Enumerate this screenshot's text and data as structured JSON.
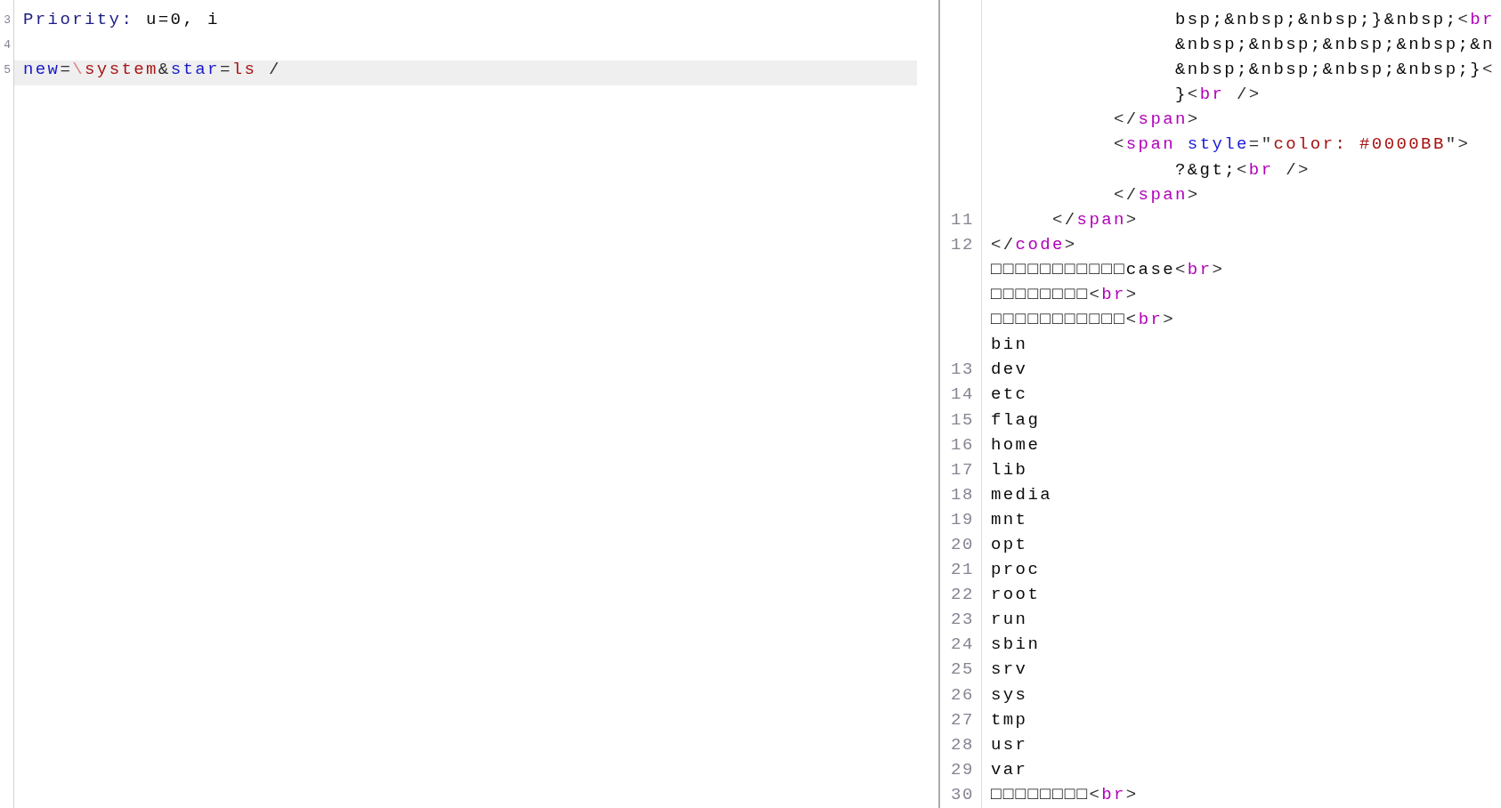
{
  "left_pane": {
    "lines": [
      {
        "number": "3",
        "highlighted": false,
        "tokens": [
          {
            "kind": "header",
            "text": "Priority:"
          },
          {
            "kind": "text",
            "text": " u=0, i"
          }
        ]
      },
      {
        "number": "4",
        "highlighted": false
      },
      {
        "number": "5",
        "highlighted": true,
        "tokens": [
          {
            "kind": "param",
            "text": "new"
          },
          {
            "kind": "punct",
            "text": "="
          },
          {
            "kind": "escape",
            "text": "\\"
          },
          {
            "kind": "value",
            "text": "system"
          },
          {
            "kind": "punct",
            "text": "&"
          },
          {
            "kind": "param",
            "text": "star"
          },
          {
            "kind": "punct",
            "text": "="
          },
          {
            "kind": "value",
            "text": "ls"
          },
          {
            "kind": "punct",
            "text": " /"
          }
        ]
      }
    ]
  },
  "right_pane": {
    "lines": [
      {
        "children": [
          {
            "children": [
              {
                "children": [
                  {
                    "tokens": [
                      {
                        "kind": "text",
                        "text": "bsp;&nbsp;&nbsp;}&nbsp;"
                      },
                      {
                        "kind": "punct",
                        "text": "<"
                      },
                      {
                        "kind": "tag",
                        "text": "br"
                      }
                    ]
                  },
                  {
                    "tokens": [
                      {
                        "kind": "text",
                        "text": "&nbsp;&nbsp;&nbsp;&nbsp;&n"
                      }
                    ]
                  },
                  {
                    "tokens": [
                      {
                        "kind": "text",
                        "text": "&nbsp;&nbsp;&nbsp;&nbsp;}"
                      },
                      {
                        "kind": "punct",
                        "text": "<"
                      }
                    ]
                  },
                  {
                    "tokens": [
                      {
                        "kind": "text",
                        "text": "}"
                      },
                      {
                        "kind": "punct",
                        "text": "<"
                      },
                      {
                        "kind": "tag",
                        "text": "br"
                      },
                      {
                        "kind": "punct",
                        "text": " />"
                      }
                    ]
                  }
                ]
              },
              {
                "tokens": [
                  {
                    "kind": "punct",
                    "text": "</"
                  },
                  {
                    "kind": "tag",
                    "text": "span"
                  },
                  {
                    "kind": "punct",
                    "text": ">"
                  }
                ]
              },
              {
                "tokens": [
                  {
                    "kind": "punct",
                    "text": "<"
                  },
                  {
                    "kind": "tag",
                    "text": "span"
                  },
                  {
                    "kind": "attr",
                    "text": " style"
                  },
                  {
                    "kind": "punct",
                    "text": "=\""
                  },
                  {
                    "kind": "string",
                    "text": "color: #0000BB"
                  },
                  {
                    "kind": "punct",
                    "text": "\">"
                  }
                ],
                "children": [
                  {
                    "tokens": [
                      {
                        "kind": "text",
                        "text": "?&gt;"
                      },
                      {
                        "kind": "punct",
                        "text": "<"
                      },
                      {
                        "kind": "tag",
                        "text": "br"
                      },
                      {
                        "kind": "punct",
                        "text": " />"
                      }
                    ]
                  }
                ]
              },
              {
                "tokens": [
                  {
                    "kind": "punct",
                    "text": "</"
                  },
                  {
                    "kind": "tag",
                    "text": "span"
                  },
                  {
                    "kind": "punct",
                    "text": ">"
                  }
                ]
              }
            ]
          },
          {
            "number": "11",
            "tokens": [
              {
                "kind": "punct",
                "text": "</"
              },
              {
                "kind": "tag",
                "text": "span"
              },
              {
                "kind": "punct",
                "text": ">"
              }
            ]
          }
        ]
      },
      {
        "number": "12",
        "tokens": [
          {
            "kind": "punct",
            "text": "</"
          },
          {
            "kind": "tag",
            "text": "code"
          },
          {
            "kind": "punct",
            "text": ">"
          }
        ]
      },
      {
        "tokens": [
          {
            "kind": "text",
            "text": "□□□□□□□□□□□case"
          },
          {
            "kind": "punct",
            "text": "<"
          },
          {
            "kind": "tag",
            "text": "br"
          },
          {
            "kind": "punct",
            "text": ">"
          }
        ]
      },
      {
        "tokens": [
          {
            "kind": "text",
            "text": "□□□□□□□□"
          },
          {
            "kind": "punct",
            "text": "<"
          },
          {
            "kind": "tag",
            "text": "br"
          },
          {
            "kind": "punct",
            "text": ">"
          }
        ]
      },
      {
        "tokens": [
          {
            "kind": "text",
            "text": "□□□□□□□□□□□"
          },
          {
            "kind": "punct",
            "text": "<"
          },
          {
            "kind": "tag",
            "text": "br"
          },
          {
            "kind": "punct",
            "text": ">"
          }
        ]
      },
      {
        "tokens": [
          {
            "kind": "text",
            "text": "bin"
          }
        ]
      },
      {
        "number": "13",
        "tokens": [
          {
            "kind": "text",
            "text": "dev"
          }
        ]
      },
      {
        "number": "14",
        "tokens": [
          {
            "kind": "text",
            "text": "etc"
          }
        ]
      },
      {
        "number": "15",
        "tokens": [
          {
            "kind": "text",
            "text": "flag"
          }
        ]
      },
      {
        "number": "16",
        "tokens": [
          {
            "kind": "text",
            "text": "home"
          }
        ]
      },
      {
        "number": "17",
        "tokens": [
          {
            "kind": "text",
            "text": "lib"
          }
        ]
      },
      {
        "number": "18",
        "tokens": [
          {
            "kind": "text",
            "text": "media"
          }
        ]
      },
      {
        "number": "19",
        "tokens": [
          {
            "kind": "text",
            "text": "mnt"
          }
        ]
      },
      {
        "number": "20",
        "tokens": [
          {
            "kind": "text",
            "text": "opt"
          }
        ]
      },
      {
        "number": "21",
        "tokens": [
          {
            "kind": "text",
            "text": "proc"
          }
        ]
      },
      {
        "number": "22",
        "tokens": [
          {
            "kind": "text",
            "text": "root"
          }
        ]
      },
      {
        "number": "23",
        "tokens": [
          {
            "kind": "text",
            "text": "run"
          }
        ]
      },
      {
        "number": "24",
        "tokens": [
          {
            "kind": "text",
            "text": "sbin"
          }
        ]
      },
      {
        "number": "25",
        "tokens": [
          {
            "kind": "text",
            "text": "srv"
          }
        ]
      },
      {
        "number": "26",
        "tokens": [
          {
            "kind": "text",
            "text": "sys"
          }
        ]
      },
      {
        "number": "27",
        "tokens": [
          {
            "kind": "text",
            "text": "tmp"
          }
        ]
      },
      {
        "number": "28",
        "tokens": [
          {
            "kind": "text",
            "text": "usr"
          }
        ]
      },
      {
        "number": "29",
        "tokens": [
          {
            "kind": "text",
            "text": "var"
          }
        ]
      },
      {
        "number": "30",
        "tokens": [
          {
            "kind": "text",
            "text": "□□□□□□□□"
          },
          {
            "kind": "punct",
            "text": "<"
          },
          {
            "kind": "tag",
            "text": "br"
          },
          {
            "kind": "punct",
            "text": ">"
          }
        ]
      }
    ]
  }
}
